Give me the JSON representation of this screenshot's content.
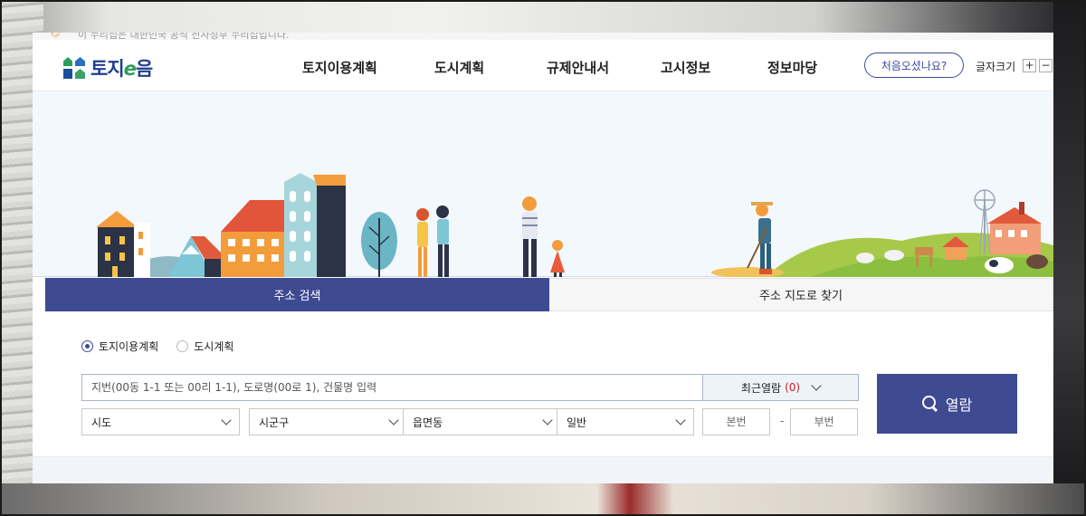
{
  "topbar": {
    "notice": "이 누리집은 대한민국 공식 전자정부 누리집입니다."
  },
  "brand": {
    "logo_main": "토지",
    "logo_e": "e",
    "logo_end": "음",
    "brand_color": "#1f3f8f",
    "accent_color": "#3e4a92"
  },
  "nav": {
    "items": [
      {
        "label": "토지이용계획"
      },
      {
        "label": "도시계획"
      },
      {
        "label": "규제안내서"
      },
      {
        "label": "고시정보"
      },
      {
        "label": "정보마당"
      }
    ],
    "first_visit": "처음오셨나요?",
    "font_size_label": "글자크기",
    "font_plus": "+",
    "font_minus": "−"
  },
  "tabs": {
    "active": "주소 검색",
    "inactive": "주소 지도로 찾기"
  },
  "search": {
    "radio_options": [
      {
        "label": "토지이용계획",
        "checked": true
      },
      {
        "label": "도시계획",
        "checked": false
      }
    ],
    "address_placeholder": "지번(00동 1-1 또는 00리 1-1), 도로명(00로 1), 건물명 입력",
    "recent_label": "최근열람",
    "recent_count": "(0)",
    "selects": [
      {
        "value": "시도"
      },
      {
        "value": "시군구"
      },
      {
        "value": "읍면동"
      },
      {
        "value": "일반"
      }
    ],
    "bonbeon_placeholder": "본번",
    "dash": "-",
    "bubeon_placeholder": "부번",
    "submit_label": "열람"
  }
}
